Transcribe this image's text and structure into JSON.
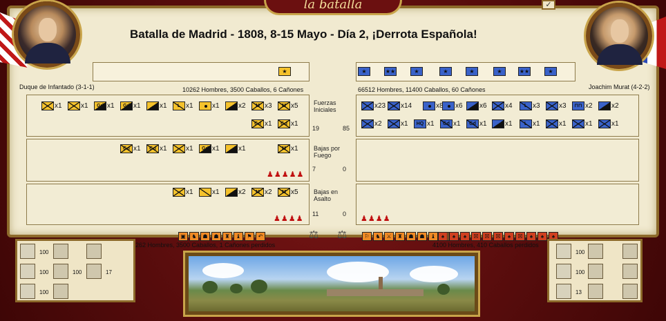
{
  "window": {
    "title": "la batalla",
    "check_glyph": "✓"
  },
  "headline": "Batalla de Madrid - 1808, 8-15 Mayo - Día 2, ¡Derrota Española!",
  "spain": {
    "commander": "Duque de Infantado (3-1-1)",
    "strength": "10262 Hombres, 3500 Caballos, 6 Cañones",
    "leader_strip": [
      "★"
    ],
    "initial": [
      {
        "icon": "infantry-icon",
        "kind": "x",
        "count": "x1"
      },
      {
        "icon": "infantry-icon",
        "kind": "x",
        "count": "x1"
      },
      {
        "icon": "guard-infantry-icon",
        "kind": "half",
        "label": "Gd",
        "count": "x1"
      },
      {
        "icon": "guard-cavalry-icon",
        "kind": "half",
        "label": "Gd",
        "count": "x1"
      },
      {
        "icon": "cavalry-icon",
        "kind": "half",
        "count": "x1"
      },
      {
        "icon": "light-cavalry-icon",
        "kind": "slash",
        "label": "L",
        "count": "x1"
      },
      {
        "icon": "artillery-icon",
        "kind": "dot",
        "count": "x1"
      },
      {
        "icon": "heavy-cavalry-icon",
        "kind": "half",
        "count": "x2"
      },
      {
        "icon": "militia-icon",
        "kind": "x",
        "label": "M",
        "count": "x3"
      },
      {
        "icon": "militia-icon",
        "kind": "x",
        "label": "M",
        "count": "x5"
      },
      {
        "icon": "guard-infantry-icon",
        "kind": "x",
        "label": "Gd",
        "count": "x1"
      },
      {
        "icon": "militia-guard-icon",
        "kind": "x",
        "label": "Gd",
        "count": "x1"
      }
    ],
    "fire_losses": [
      {
        "icon": "guard-infantry-icon",
        "kind": "x",
        "label": "Gd",
        "count": "x1"
      },
      {
        "icon": "guard-infantry-icon",
        "kind": "x",
        "label": "Gd",
        "count": "x1"
      },
      {
        "icon": "infantry-icon",
        "kind": "x",
        "count": "x1"
      },
      {
        "icon": "guard-cavalry-icon",
        "kind": "half",
        "label": "Gd",
        "count": "x1"
      },
      {
        "icon": "cavalry-icon",
        "kind": "half",
        "count": "x1"
      },
      {
        "icon": "militia-icon",
        "kind": "x",
        "label": "M",
        "count": "x1"
      }
    ],
    "assault_losses": [
      {
        "icon": "infantry-icon",
        "kind": "x",
        "count": "x1"
      },
      {
        "icon": "light-cavalry-icon",
        "kind": "slash",
        "count": "x1"
      },
      {
        "icon": "cavalry-icon",
        "kind": "half",
        "count": "x2"
      },
      {
        "icon": "militia-icon",
        "kind": "x",
        "label": "M",
        "count": "x2"
      },
      {
        "icon": "militia-icon",
        "kind": "x",
        "label": "M",
        "count": "x5"
      }
    ],
    "fire_men": "♟♟♟♟♟",
    "assault_men": "♟♟♟♟",
    "losses_summary": "10262 Hombres, 3500 Caballos, 1 Cañones perdidos",
    "stats": [
      {
        "icon": "tent-icon",
        "value": "100"
      },
      {
        "icon": "cannonball-icon",
        "value": "100"
      },
      {
        "icon": "wagon-icon",
        "value": "100"
      }
    ],
    "extra_stats": [
      {
        "value": "100"
      },
      {
        "value": "17"
      }
    ]
  },
  "france": {
    "commander": "Joachim Murat (4-2-2)",
    "strength": "66512 Hombres, 11400 Caballos, 60 Cañones",
    "leader_strip": [
      "★",
      "★★",
      "★",
      "★",
      "★",
      "★",
      "★★",
      "★"
    ],
    "initial": [
      {
        "icon": "infantry-icon",
        "kind": "x",
        "count": "x23"
      },
      {
        "icon": "infantry-icon",
        "kind": "x",
        "count": "x14"
      },
      {
        "icon": "artillery-icon",
        "kind": "dot",
        "count": "x8"
      },
      {
        "icon": "artillery-icon",
        "kind": "dot",
        "count": "x6"
      },
      {
        "icon": "cavalry-icon",
        "kind": "half",
        "count": "x6"
      },
      {
        "icon": "engineer-icon",
        "kind": "x",
        "count": "x4"
      },
      {
        "icon": "light-cavalry-icon",
        "kind": "slash",
        "label": "L",
        "count": "x3"
      },
      {
        "icon": "infantry-icon",
        "kind": "x",
        "count": "x3"
      },
      {
        "icon": "bridge-icon",
        "kind": "none",
        "label": "⊓⊓",
        "count": "x2"
      },
      {
        "icon": "heavy-cavalry-icon",
        "kind": "half",
        "count": "x2"
      },
      {
        "icon": "infantry-icon",
        "kind": "x",
        "count": "x2"
      },
      {
        "icon": "infantry-icon",
        "kind": "x",
        "count": "x1"
      },
      {
        "icon": "hq-icon",
        "kind": "none",
        "label": "HQ",
        "count": "x1"
      },
      {
        "icon": "guard-cavalry-icon",
        "kind": "slash",
        "label": "Gd",
        "count": "x1"
      },
      {
        "icon": "guard-cavalry-icon",
        "kind": "slash",
        "label": "Gd",
        "count": "x1"
      },
      {
        "icon": "cavalry-icon",
        "kind": "half",
        "count": "x1"
      },
      {
        "icon": "light-cavalry-icon",
        "kind": "slash",
        "label": "L",
        "count": "x1"
      },
      {
        "icon": "infantry-icon",
        "kind": "x",
        "count": "x1"
      },
      {
        "icon": "infantry-icon",
        "kind": "x",
        "count": "x1"
      },
      {
        "icon": "infantry-icon",
        "kind": "x",
        "count": "x1"
      }
    ],
    "assault_men": "♟♟♟♟",
    "losses_summary": "4100 Hombres, 410 Caballos perdidos",
    "stats": [
      {
        "icon": "tent-icon",
        "value": "100"
      },
      {
        "icon": "cannonball-icon",
        "value": "100"
      },
      {
        "icon": "wagon-icon",
        "value": "13"
      }
    ]
  },
  "center": {
    "initial_label": "Fuerzas Iniciales",
    "initial_es": "19",
    "initial_fr": "85",
    "fire_label": "Bajas por Fuego",
    "fire_es": "7",
    "fire_fr": "0",
    "assault_label": "Bajas en Asalto",
    "assault_es": "11",
    "assault_fr": "0"
  },
  "modifiers": {
    "spain": [
      "▣",
      "♞",
      "☗",
      "☗",
      "♜",
      "♝",
      "⚑",
      "↶"
    ],
    "france": [
      "⚐",
      "♞",
      "⚔",
      "♜",
      "☗",
      "☗",
      "♝",
      "⚑"
    ],
    "france_losses": [
      "♠",
      "♠",
      "♠",
      "☒",
      "☒",
      "☒",
      "♠",
      "☒",
      "♠",
      "♠",
      "♠"
    ],
    "scales_glyph": "⚖"
  },
  "colors": {
    "spain": "#f5c22c",
    "france": "#3a62c9",
    "parchment": "#f1ead0",
    "frame": "#6b1010",
    "gold": "#c9a44a"
  }
}
